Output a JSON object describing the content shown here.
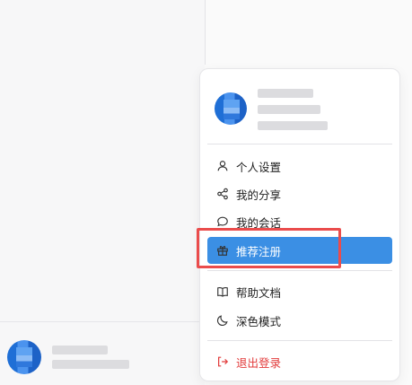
{
  "menu": {
    "items": [
      {
        "label": "个人设置",
        "icon": "user-icon"
      },
      {
        "label": "我的分享",
        "icon": "share-icon"
      },
      {
        "label": "我的会话",
        "icon": "chat-bubble-icon"
      },
      {
        "label": "推荐注册",
        "icon": "gift-icon",
        "active": true
      },
      {
        "label": "帮助文档",
        "icon": "book-icon"
      },
      {
        "label": "深色模式",
        "icon": "moon-icon"
      },
      {
        "label": "退出登录",
        "icon": "logout-icon"
      }
    ]
  },
  "colors": {
    "active_bg": "#3b8fe4",
    "logout": "#e23b3b",
    "highlight_border": "#ea4c4c"
  }
}
